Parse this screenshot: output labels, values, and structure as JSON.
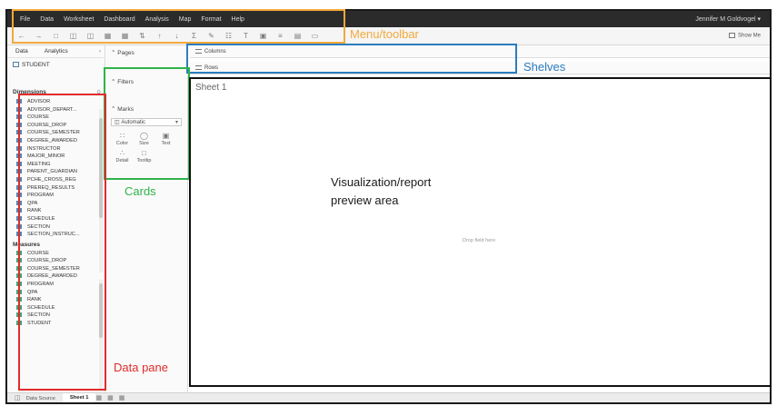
{
  "menubar": {
    "items": [
      "File",
      "Data",
      "Worksheet",
      "Dashboard",
      "Analysis",
      "Map",
      "Format",
      "Help"
    ],
    "user": "Jennifer M Goldvogel ▾"
  },
  "toolbar": {
    "icons": [
      "back-icon",
      "forward-icon",
      "save-icon",
      "new-datasource-icon",
      "new-worksheet-icon",
      "duplicate-icon",
      "clear-icon",
      "swap-icon",
      "sort-ascending-icon",
      "sort-descending-icon",
      "totals-icon",
      "highlight-icon",
      "group-icon",
      "label-icon",
      "fit-icon",
      "fix-axes-icon",
      "show-cards-icon",
      "presentation-icon"
    ],
    "show_me": "Show Me"
  },
  "data_pane": {
    "tabs": [
      "Data",
      "Analytics"
    ],
    "datasource": "STUDENT",
    "dimensions_label": "Dimensions",
    "dimensions": [
      "ADVISOR",
      "ADVISOR_DEPART...",
      "COURSE",
      "COURSE_DROP",
      "COURSE_SEMESTER",
      "DEGREE_AWARDED",
      "INSTRUCTOR",
      "MAJOR_MINOR",
      "MEETING",
      "PARENT_GUARDIAN",
      "PCHE_CROSS_REG",
      "PREREQ_RESULTS",
      "PROGRAM",
      "QPA",
      "RANK",
      "SCHEDULE",
      "SECTION",
      "SECTION_INSTRUC..."
    ],
    "measures_label": "Measures",
    "measures": [
      "COURSE",
      "COURSE_DROP",
      "COURSE_SEMESTER",
      "DEGREE_AWARDED",
      "PROGRAM",
      "QPA",
      "RANK",
      "SCHEDULE",
      "SECTION",
      "STUDENT"
    ]
  },
  "cards": {
    "pages": "Pages",
    "filters": "Filters",
    "marks": "Marks",
    "marks_type": "Automatic",
    "mark_buttons": [
      "Color",
      "Size",
      "Text",
      "Detail",
      "Tooltip"
    ]
  },
  "shelves": {
    "columns": "Columns",
    "rows": "Rows"
  },
  "viz": {
    "sheet_title": "Sheet 1",
    "drop_hint": "Drop field here"
  },
  "tabbar": {
    "data_source": "Data Source",
    "sheet": "Sheet 1"
  },
  "annotations": {
    "menu": "Menu/toolbar",
    "shelves": "Shelves",
    "cards": "Cards",
    "data_pane": "Data pane",
    "viz_line1": "Visualization/report",
    "viz_line2": "preview area"
  },
  "colors": {
    "menu": "#f3a93b",
    "shelves": "#2c7cbf",
    "cards": "#2fb34a",
    "data_pane": "#e12b2b",
    "viz": "#111111"
  }
}
